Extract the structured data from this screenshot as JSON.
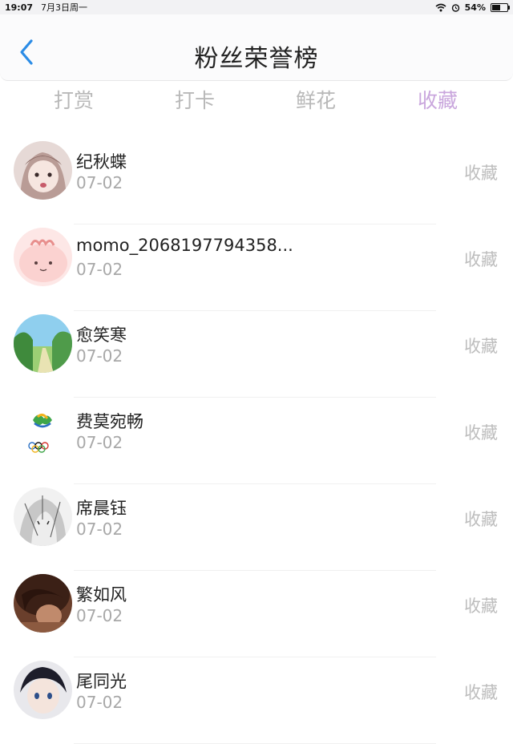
{
  "status_bar": {
    "time": "19:07",
    "date": "7月3日周一",
    "battery_percent": "54%",
    "battery_level": 0.54
  },
  "header": {
    "title": "粉丝荣誉榜",
    "back_icon": "chevron-left-icon",
    "accent_color": "#2b8ce6"
  },
  "tabs": [
    {
      "label": "打赏",
      "active": false
    },
    {
      "label": "打卡",
      "active": false
    },
    {
      "label": "鲜花",
      "active": false
    },
    {
      "label": "收藏",
      "active": true
    }
  ],
  "active_tab_color": "#c9a6dd",
  "fans": [
    {
      "name": "纪秋蝶",
      "date": "07-02",
      "action": "收藏"
    },
    {
      "name": "momo_2068197794358...",
      "date": "07-02",
      "action": "收藏"
    },
    {
      "name": "愈笑寒",
      "date": "07-02",
      "action": "收藏"
    },
    {
      "name": "费莫宛畅",
      "date": "07-02",
      "action": "收藏"
    },
    {
      "name": "席晨钰",
      "date": "07-02",
      "action": "收藏"
    },
    {
      "name": "繁如风",
      "date": "07-02",
      "action": "收藏"
    },
    {
      "name": "尾同光",
      "date": "07-02",
      "action": "收藏"
    }
  ]
}
